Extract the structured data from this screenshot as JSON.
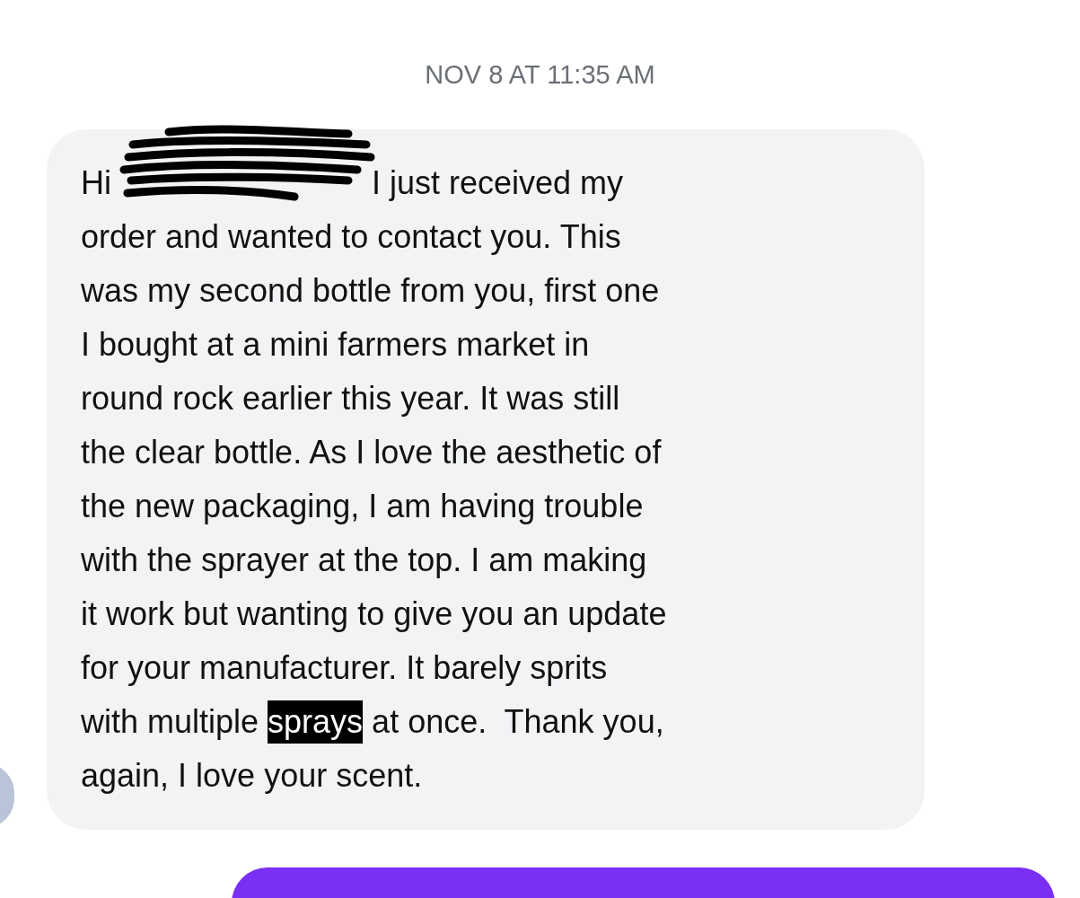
{
  "timestamp": "NOV 8 AT 11:35 AM",
  "incoming_message": {
    "lines": [
      [
        {
          "kind": "text",
          "text": "Hi"
        },
        {
          "kind": "redaction"
        },
        {
          "kind": "text",
          "text": "I just received my"
        }
      ],
      [
        {
          "kind": "text",
          "text": "order and wanted to contact you. This"
        }
      ],
      [
        {
          "kind": "text",
          "text": "was my second bottle from you, first one"
        }
      ],
      [
        {
          "kind": "text",
          "text": "I bought at a mini farmers market in"
        }
      ],
      [
        {
          "kind": "text",
          "text": "round rock earlier this year. It was still"
        }
      ],
      [
        {
          "kind": "text",
          "text": "the clear bottle. As I love the aesthetic of"
        }
      ],
      [
        {
          "kind": "text",
          "text": "the new packaging, I am having trouble"
        }
      ],
      [
        {
          "kind": "text",
          "text": "with the sprayer at the top. I am making"
        }
      ],
      [
        {
          "kind": "text",
          "text": "it work but wanting to give you an update"
        }
      ],
      [
        {
          "kind": "text",
          "text": "for your manufacturer. It barely sprits"
        }
      ],
      [
        {
          "kind": "text",
          "text": "with multiple"
        },
        {
          "kind": "highlight",
          "text": "sprays"
        },
        {
          "kind": "text",
          "text": "at once.  Thank you,"
        }
      ],
      [
        {
          "kind": "text",
          "text": "again, I love your scent."
        }
      ]
    ]
  }
}
